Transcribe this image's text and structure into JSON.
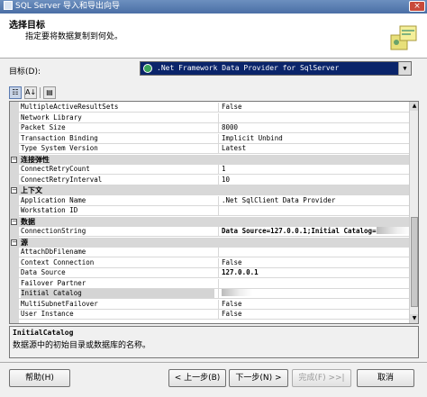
{
  "window": {
    "title": "SQL Server 导入和导出向导",
    "close_label": "×"
  },
  "header": {
    "title": "选择目标",
    "subtitle": "指定要将数据复制到何处。"
  },
  "destination": {
    "label": "目标(D):",
    "selected": ".Net Framework Data Provider for SqlServer",
    "arrow": "▼"
  },
  "toolbar": {
    "categorized": "☷",
    "alphabetical": "A↓",
    "property_pages": "▤"
  },
  "grid": {
    "rows": [
      {
        "kind": "prop",
        "name": "MultipleActiveResultSets",
        "value": "False"
      },
      {
        "kind": "prop",
        "name": "Network Library",
        "value": ""
      },
      {
        "kind": "prop",
        "name": "Packet Size",
        "value": "8000"
      },
      {
        "kind": "prop",
        "name": "Transaction Binding",
        "value": "Implicit Unbind"
      },
      {
        "kind": "prop",
        "name": "Type System Version",
        "value": "Latest"
      },
      {
        "kind": "cat",
        "name": "连接弹性",
        "toggle": "−"
      },
      {
        "kind": "prop",
        "name": "ConnectRetryCount",
        "value": "1"
      },
      {
        "kind": "prop",
        "name": "ConnectRetryInterval",
        "value": "10"
      },
      {
        "kind": "cat",
        "name": "上下文",
        "toggle": "−"
      },
      {
        "kind": "prop",
        "name": "Application Name",
        "value": ".Net SqlClient Data Provider"
      },
      {
        "kind": "prop",
        "name": "Workstation ID",
        "value": ""
      },
      {
        "kind": "cat",
        "name": "数据",
        "toggle": "−"
      },
      {
        "kind": "prop",
        "name": "ConnectionString",
        "value": "Data Source=127.0.0.1;Initial Catalog=",
        "bold": true
      },
      {
        "kind": "cat",
        "name": "源",
        "toggle": "−"
      },
      {
        "kind": "prop",
        "name": "AttachDbFilename",
        "value": ""
      },
      {
        "kind": "prop",
        "name": "Context Connection",
        "value": "False"
      },
      {
        "kind": "prop",
        "name": "Data Source",
        "value": "127.0.0.1",
        "bold": true
      },
      {
        "kind": "prop",
        "name": "Failover Partner",
        "value": ""
      },
      {
        "kind": "prop",
        "name": "Initial Catalog",
        "value": "",
        "selected": true
      },
      {
        "kind": "prop",
        "name": "MultiSubnetFailover",
        "value": "False"
      },
      {
        "kind": "prop",
        "name": "User Instance",
        "value": "False"
      }
    ]
  },
  "scrollbar": {
    "up": "▲",
    "down": "▼"
  },
  "description": {
    "title": "InitialCatalog",
    "text": "数据源中的初始目录或数据库的名称。"
  },
  "buttons": {
    "help": "帮助(H)",
    "back": "< 上一步(B)",
    "next": "下一步(N) >",
    "finish": "完成(F) >>|",
    "cancel": "取消"
  }
}
